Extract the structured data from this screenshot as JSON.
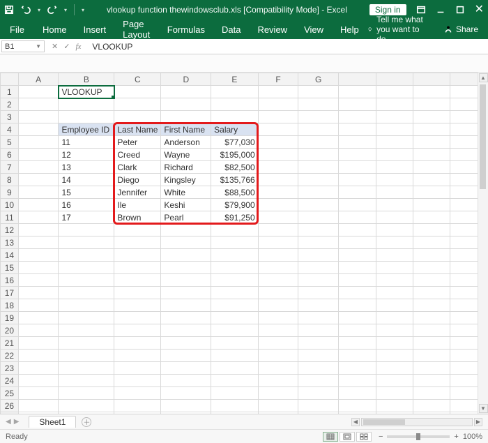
{
  "titlebar": {
    "doc_title": "vlookup function thewindowsclub.xls  [Compatibility Mode]  -  Excel",
    "signin_label": "Sign in"
  },
  "ribbon": {
    "tabs": [
      "File",
      "Home",
      "Insert",
      "Page Layout",
      "Formulas",
      "Data",
      "Review",
      "View",
      "Help"
    ],
    "tell_me": "Tell me what you want to do",
    "share": "Share"
  },
  "formula_bar": {
    "namebox": "B1",
    "formula": "VLOOKUP"
  },
  "columns": [
    "A",
    "B",
    "C",
    "D",
    "E",
    "F",
    "G"
  ],
  "cell_B1": "VLOOKUP",
  "table": {
    "headers": [
      "Employee ID",
      "Last Name",
      "First Name",
      "Salary"
    ],
    "rows": [
      {
        "id": "11",
        "last": "Peter",
        "first": "Anderson",
        "salary": "$77,030"
      },
      {
        "id": "12",
        "last": "Creed",
        "first": "Wayne",
        "salary": "$195,000"
      },
      {
        "id": "13",
        "last": "Clark",
        "first": "Richard",
        "salary": "$82,500"
      },
      {
        "id": "14",
        "last": "Diego",
        "first": "Kingsley",
        "salary": "$135,766"
      },
      {
        "id": "15",
        "last": "Jennifer",
        "first": "White",
        "salary": "$88,500"
      },
      {
        "id": "16",
        "last": "Ile",
        "first": "Keshi",
        "salary": "$79,900"
      },
      {
        "id": "17",
        "last": "Brown",
        "first": "Pearl",
        "salary": "$91,250"
      }
    ]
  },
  "sheet_tab": "Sheet1",
  "statusbar": {
    "ready": "Ready",
    "zoom": "100%"
  },
  "row_count": 27
}
